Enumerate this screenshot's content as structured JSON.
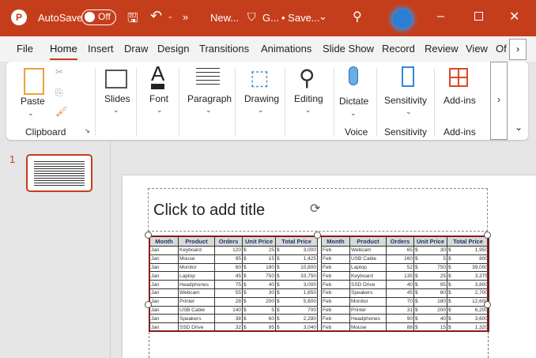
{
  "titlebar": {
    "autosave": "AutoSave",
    "toggle": "Off",
    "filename": "New...",
    "sensitivity": "G...",
    "status": "• Save..."
  },
  "tabs": [
    "File",
    "Home",
    "Insert",
    "Draw",
    "Design",
    "Transitions",
    "Animations",
    "Slide Show",
    "Record",
    "Review",
    "View",
    "Of"
  ],
  "ribbon": {
    "paste": "Paste",
    "clipboard": "Clipboard",
    "slides": "Slides",
    "font": "Font",
    "paragraph": "Paragraph",
    "drawing": "Drawing",
    "editing": "Editing",
    "dictate": "Dictate",
    "voice": "Voice",
    "sensitivity": "Sensitivity",
    "sensitivity_group": "Sensitivity",
    "addins": "Add-ins",
    "addins_group": "Add-ins"
  },
  "slide_number": "1",
  "slide": {
    "title_placeholder": "Click to add title"
  },
  "table": {
    "headers": [
      "Month",
      "Product",
      "Orders",
      "Unit Price",
      "Total Price"
    ],
    "left": [
      [
        "Jan",
        "Keyboard",
        "120",
        "25",
        "3,000"
      ],
      [
        "Jan",
        "Mouse",
        "95",
        "15",
        "1,425"
      ],
      [
        "Jan",
        "Monitor",
        "60",
        "180",
        "10,800"
      ],
      [
        "Jan",
        "Laptop",
        "45",
        "750",
        "33,750"
      ],
      [
        "Jan",
        "Headphones",
        "75",
        "40",
        "3,000"
      ],
      [
        "Jan",
        "Webcam",
        "55",
        "30",
        "1,650"
      ],
      [
        "Jan",
        "Printer",
        "28",
        "200",
        "5,600"
      ],
      [
        "Jan",
        "USB Cable",
        "140",
        "5",
        "700"
      ],
      [
        "Jan",
        "Speakers",
        "38",
        "60",
        "2,280"
      ],
      [
        "Jan",
        "SSD Drive",
        "32",
        "95",
        "3,040"
      ]
    ],
    "right": [
      [
        "Feb",
        "Webcam",
        "65",
        "30",
        "1,950"
      ],
      [
        "Feb",
        "USB Cable",
        "160",
        "5",
        "800"
      ],
      [
        "Feb",
        "Laptop",
        "52",
        "750",
        "39,000"
      ],
      [
        "Feb",
        "Keyboard",
        "135",
        "25",
        "3,375"
      ],
      [
        "Feb",
        "SSD Drive",
        "40",
        "95",
        "3,800"
      ],
      [
        "Feb",
        "Speakers",
        "45",
        "60",
        "2,700"
      ],
      [
        "Feb",
        "Monitor",
        "70",
        "180",
        "12,600"
      ],
      [
        "Feb",
        "Printer",
        "31",
        "200",
        "6,200"
      ],
      [
        "Feb",
        "Headphones",
        "90",
        "40",
        "3,600"
      ],
      [
        "Feb",
        "Mouse",
        "88",
        "15",
        "1,320"
      ]
    ],
    "currency": "$"
  }
}
